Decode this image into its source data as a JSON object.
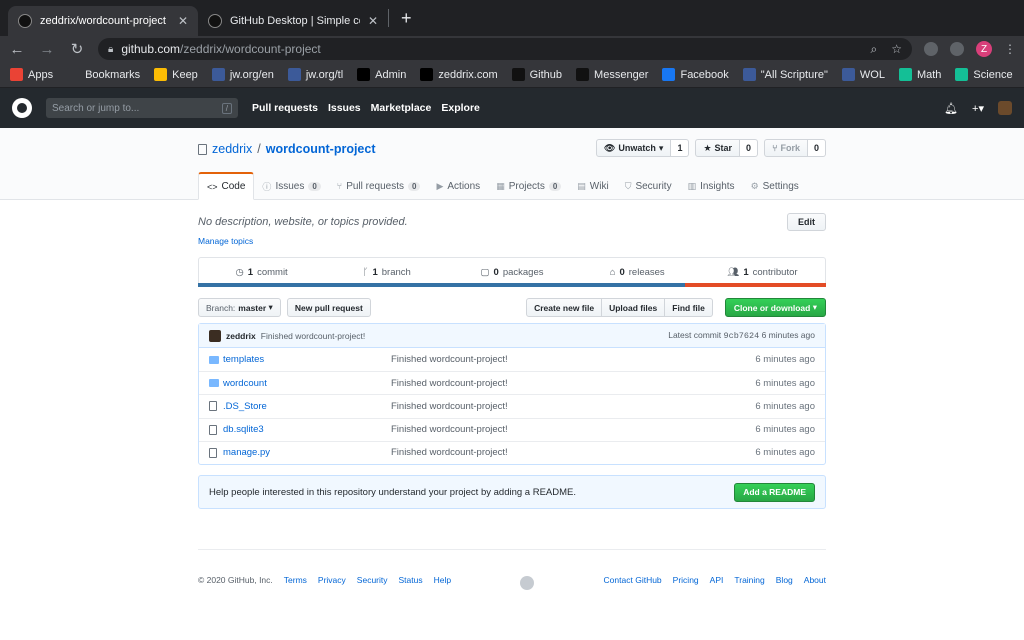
{
  "browser": {
    "tabs": [
      {
        "title": "zeddrix/wordcount-project",
        "active": true
      },
      {
        "title": "GitHub Desktop | Simple collabo",
        "active": false
      }
    ],
    "url_host": "github.com",
    "url_path": "/zeddrix/wordcount-project",
    "profile_initial": "Z",
    "bookmarks": [
      {
        "label": "Apps",
        "color": "#ea4335"
      },
      {
        "label": "Bookmarks",
        "color": "#35363a"
      },
      {
        "label": "Keep",
        "color": "#fbbc04"
      },
      {
        "label": "jw.org/en",
        "color": "#3c5a99"
      },
      {
        "label": "jw.org/tl",
        "color": "#3c5a99"
      },
      {
        "label": "Admin",
        "color": "#000000"
      },
      {
        "label": "zeddrix.com",
        "color": "#000000"
      },
      {
        "label": "Github",
        "color": "#111111"
      },
      {
        "label": "Messenger",
        "color": "#111111"
      },
      {
        "label": "Facebook",
        "color": "#1877f2"
      },
      {
        "label": "\"All Scripture\"",
        "color": "#3c5a99"
      },
      {
        "label": "WOL",
        "color": "#3c5a99"
      },
      {
        "label": "Math",
        "color": "#14bf96"
      },
      {
        "label": "Science",
        "color": "#14bf96"
      }
    ],
    "bookmarks_more": "»"
  },
  "gh_header": {
    "search_placeholder": "Search or jump to...",
    "search_key": "/",
    "nav": [
      "Pull requests",
      "Issues",
      "Marketplace",
      "Explore"
    ]
  },
  "repo": {
    "owner": "zeddrix",
    "separator": "/",
    "name": "wordcount-project",
    "watch_label": "Unwatch",
    "watch_count": "1",
    "star_label": "Star",
    "star_count": "0",
    "fork_label": "Fork",
    "fork_count": "0",
    "tabs": [
      {
        "label": "Code",
        "icon": "<>",
        "count": ""
      },
      {
        "label": "Issues",
        "icon": "ⓘ",
        "count": "0"
      },
      {
        "label": "Pull requests",
        "icon": "⑂",
        "count": "0"
      },
      {
        "label": "Actions",
        "icon": "▶",
        "count": ""
      },
      {
        "label": "Projects",
        "icon": "▦",
        "count": "0"
      },
      {
        "label": "Wiki",
        "icon": "▤",
        "count": ""
      },
      {
        "label": "Security",
        "icon": "⛉",
        "count": ""
      },
      {
        "label": "Insights",
        "icon": "▥",
        "count": ""
      },
      {
        "label": "Settings",
        "icon": "⚙",
        "count": ""
      }
    ],
    "description": "No description, website, or topics provided.",
    "edit_label": "Edit",
    "manage_topics": "Manage topics",
    "summary": [
      {
        "count": "1",
        "label": "commit"
      },
      {
        "count": "1",
        "label": "branch"
      },
      {
        "count": "0",
        "label": "packages"
      },
      {
        "count": "0",
        "label": "releases"
      },
      {
        "count": "1",
        "label": "contributor"
      }
    ],
    "branch_prefix": "Branch:",
    "branch": "master",
    "new_pr": "New pull request",
    "create_file": "Create new file",
    "upload_files": "Upload files",
    "find_file": "Find file",
    "clone_label": "Clone or download",
    "commit": {
      "author": "zeddrix",
      "message": "Finished wordcount-project!",
      "latest_prefix": "Latest commit",
      "sha": "9cb7624",
      "age": "6 minutes ago"
    },
    "files": [
      {
        "name": "templates",
        "type": "dir",
        "message": "Finished wordcount-project!",
        "age": "6 minutes ago"
      },
      {
        "name": "wordcount",
        "type": "dir",
        "message": "Finished wordcount-project!",
        "age": "6 minutes ago"
      },
      {
        "name": ".DS_Store",
        "type": "file",
        "message": "Finished wordcount-project!",
        "age": "6 minutes ago"
      },
      {
        "name": "db.sqlite3",
        "type": "file",
        "message": "Finished wordcount-project!",
        "age": "6 minutes ago"
      },
      {
        "name": "manage.py",
        "type": "file",
        "message": "Finished wordcount-project!",
        "age": "6 minutes ago"
      }
    ],
    "readme_banner": "Help people interested in this repository understand your project by adding a README.",
    "readme_btn": "Add a README"
  },
  "footer": {
    "copyright": "© 2020 GitHub, Inc.",
    "left_links": [
      "Terms",
      "Privacy",
      "Security",
      "Status",
      "Help"
    ],
    "right_links": [
      "Contact GitHub",
      "Pricing",
      "API",
      "Training",
      "Blog",
      "About"
    ]
  },
  "colors": {
    "lang_primary": "#3572A5",
    "lang_secondary": "#e34c26",
    "accent_green": "#28a745",
    "link_blue": "#0366d6"
  }
}
